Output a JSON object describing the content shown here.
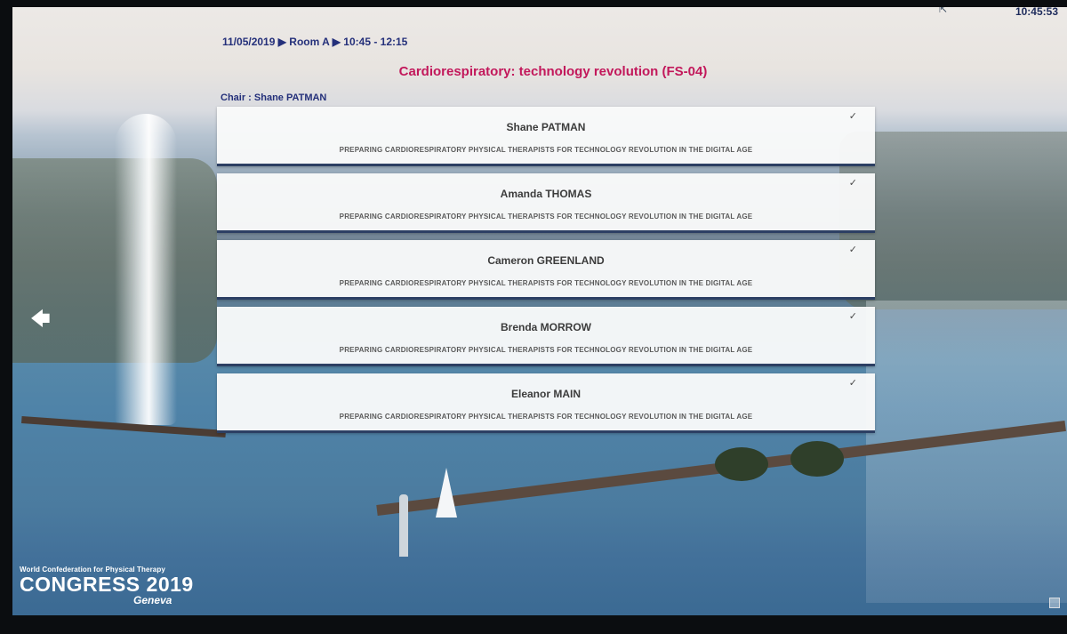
{
  "header": {
    "session_info": "11/05/2019 ▶ Room A ▶ 10:45 - 12:15",
    "session_title": "Cardiorespiratory: technology revolution (FS-04)",
    "chair": "Chair : Shane PATMAN",
    "clock": "10:45:53"
  },
  "speakers": [
    {
      "name": "Shane PATMAN",
      "talk": "PREPARING CARDIORESPIRATORY PHYSICAL THERAPISTS FOR TECHNOLOGY REVOLUTION IN THE DIGITAL AGE",
      "check": "✓"
    },
    {
      "name": "Amanda THOMAS",
      "talk": "PREPARING CARDIORESPIRATORY PHYSICAL THERAPISTS FOR TECHNOLOGY REVOLUTION IN THE DIGITAL AGE",
      "check": "✓"
    },
    {
      "name": "Cameron GREENLAND",
      "talk": "PREPARING CARDIORESPIRATORY PHYSICAL THERAPISTS FOR TECHNOLOGY REVOLUTION IN THE DIGITAL AGE",
      "check": "✓"
    },
    {
      "name": "Brenda MORROW",
      "talk": "PREPARING CARDIORESPIRATORY PHYSICAL THERAPISTS FOR TECHNOLOGY REVOLUTION IN THE DIGITAL AGE",
      "check": "✓"
    },
    {
      "name": "Eleanor MAIN",
      "talk": "PREPARING CARDIORESPIRATORY PHYSICAL THERAPISTS FOR TECHNOLOGY REVOLUTION IN THE DIGITAL AGE",
      "check": "✓"
    }
  ],
  "navigation": {
    "back_icon": "left-arrow-icon"
  },
  "logo": {
    "org": "World Confederation for Physical Therapy",
    "main": "CONGRESS 2019",
    "city": "Geneva"
  },
  "colors": {
    "title": "#c2185b",
    "header_text": "#24307a",
    "card_border": "#2c3f63"
  }
}
